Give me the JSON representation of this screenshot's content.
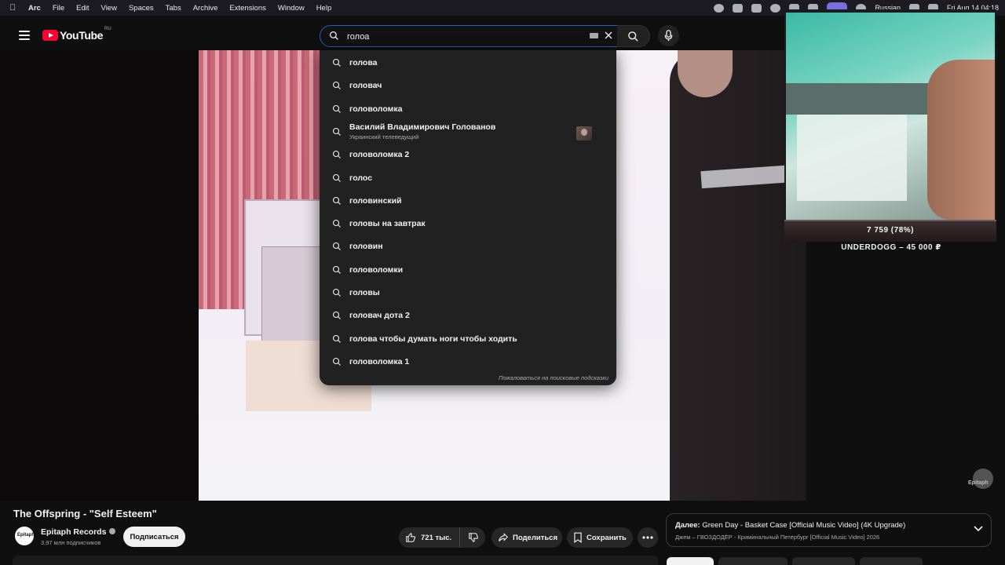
{
  "menubar": {
    "app": "Arc",
    "items": [
      "File",
      "Edit",
      "View",
      "Spaces",
      "Tabs",
      "Archive",
      "Extensions",
      "Window",
      "Help"
    ],
    "language": "Russian",
    "clock": "Fri Aug 14 04:18"
  },
  "header": {
    "logo_text": "YouTube",
    "region": "RU",
    "search_value": "голоа"
  },
  "suggestions": [
    {
      "text": "голова"
    },
    {
      "text": "головач"
    },
    {
      "text": "головоломка"
    },
    {
      "text": "Василий Владимирович Голованов",
      "subtitle": "Украинский телеведущий",
      "has_thumbnail": true
    },
    {
      "text": "головоломка 2"
    },
    {
      "text": "голос"
    },
    {
      "text": "головинский"
    },
    {
      "text": "головы на завтрак"
    },
    {
      "text": "головин"
    },
    {
      "text": "головоломки"
    },
    {
      "text": "головы"
    },
    {
      "text": "головач дота 2"
    },
    {
      "text": "голова чтобы думать ноги чтобы ходить"
    },
    {
      "text": "головоломка 1"
    }
  ],
  "suggestions_report": "Пожаловаться на поисковые подсказки",
  "stream_overlay": {
    "goal": "7 759 (78%)",
    "donation": "UNDERDOGG – 45 000 ₽"
  },
  "watermark": "Epitaph",
  "video": {
    "title": "The Offspring - \"Self Esteem\"",
    "channel": "Epitaph Records",
    "channel_avatar": "Epitaph",
    "subscribers": "3,97 млн подписчиков",
    "subscribe_label": "Подписаться",
    "likes": "721 тыс.",
    "share_label": "Поделиться",
    "save_label": "Сохранить"
  },
  "next_up": {
    "label": "Далее:",
    "title": "Green Day - Basket Case [Official Music Video] (4K Upgrade)",
    "subtitle": "Джем – ГВОЗДОДЁР - Криминальный Петербург [Official Music Video] 2026"
  },
  "colors": {
    "accent_blue": "#1c62b9",
    "youtube_red": "#ff0033",
    "background": "#0f0f0f",
    "dropdown": "#212121"
  }
}
